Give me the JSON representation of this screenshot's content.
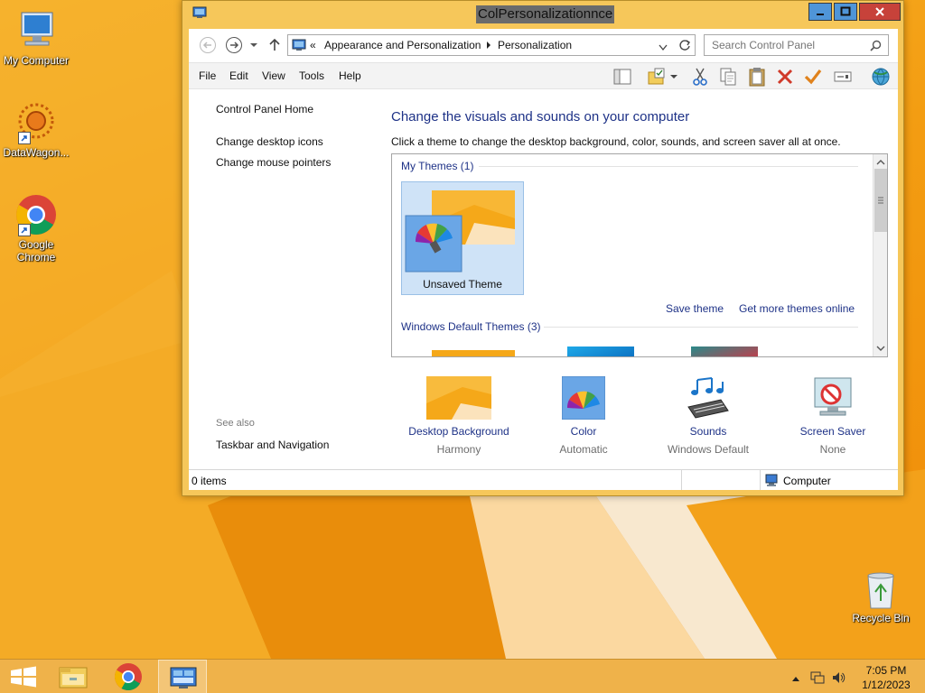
{
  "desktop": {
    "icons": [
      {
        "label": "My Computer"
      },
      {
        "label": "DataWagon..."
      },
      {
        "label": "Google Chrome"
      },
      {
        "label": "Recycle Bin"
      }
    ]
  },
  "window": {
    "title": "ColPersonalizationnce",
    "breadcrumb": {
      "prefix": "«",
      "items": [
        "Appearance and Personalization",
        "Personalization"
      ]
    },
    "search_placeholder": "Search Control Panel",
    "menu": [
      "File",
      "Edit",
      "View",
      "Tools",
      "Help"
    ],
    "leftnav": {
      "home": "Control Panel Home",
      "links": [
        "Change desktop icons",
        "Change mouse pointers"
      ],
      "see_also_label": "See also",
      "see_also_links": [
        "Taskbar and Navigation"
      ]
    },
    "main": {
      "heading": "Change the visuals and sounds on your computer",
      "subheading": "Click a theme to change the desktop background, color, sounds, and screen saver all at once.",
      "group_my_themes": "My Themes (1)",
      "theme_tile_label": "Unsaved Theme",
      "save_theme": "Save theme",
      "get_more": "Get more themes online",
      "group_default": "Windows Default Themes (3)"
    },
    "settings": [
      {
        "title": "Desktop Background",
        "value": "Harmony"
      },
      {
        "title": "Color",
        "value": "Automatic"
      },
      {
        "title": "Sounds",
        "value": "Windows Default"
      },
      {
        "title": "Screen Saver",
        "value": "None"
      }
    ],
    "status": {
      "items": "0 items",
      "location": "Computer"
    }
  },
  "taskbar": {
    "time": "7:05 PM",
    "date": "1/12/2023"
  },
  "colors": {
    "link": "#1e3287",
    "accent": "#f39d12",
    "close": "#c7423a",
    "minmax": "#4f95d8"
  }
}
